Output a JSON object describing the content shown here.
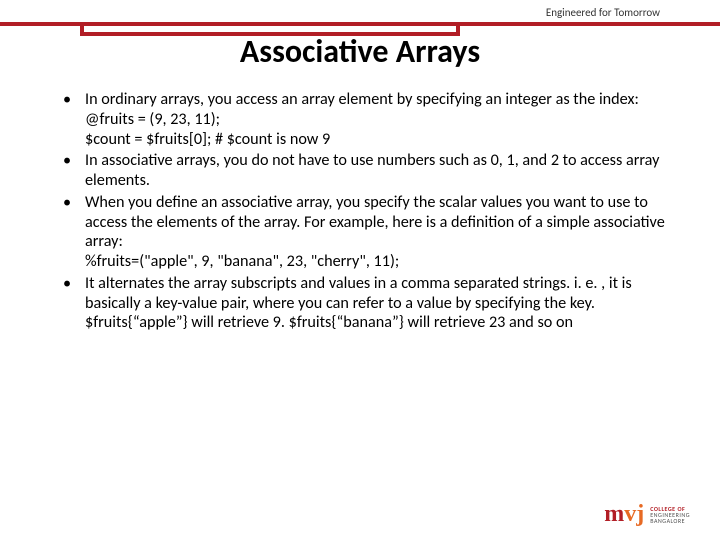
{
  "tagline": "Engineered for Tomorrow",
  "title": "Associative Arrays",
  "bullets": [
    {
      "text": "In ordinary arrays, you access an array element by specifying an integer as the index:",
      "subs": [
        "@fruits = (9, 23, 11);",
        "$count = $fruits[0];     # $count is now 9"
      ]
    },
    {
      "text": "In associative arrays, you do not have to use numbers such as 0, 1, and 2 to access array elements.",
      "subs": []
    },
    {
      "text": "When you define an associative array, you specify the scalar values you want to use to access the elements of the array. For example, here is a definition of a simple associative array:",
      "subs": [
        "%fruits=(\"apple\", 9, \"banana\", 23, \"cherry\", 11);"
      ]
    },
    {
      "text": "It alternates the array subscripts and values in a comma separated strings. i. e. , it is basically a key-value pair, where you can refer to a value by specifying the key.",
      "subs": [
        "$fruits{“apple”} will retrieve 9. $fruits{“banana”} will retrieve 23 and so on"
      ]
    }
  ],
  "logo": {
    "m": "m",
    "vj": "vj",
    "line1": "COLLEGE OF",
    "line2": "ENGINEERING",
    "line3": "BANGALORE"
  }
}
